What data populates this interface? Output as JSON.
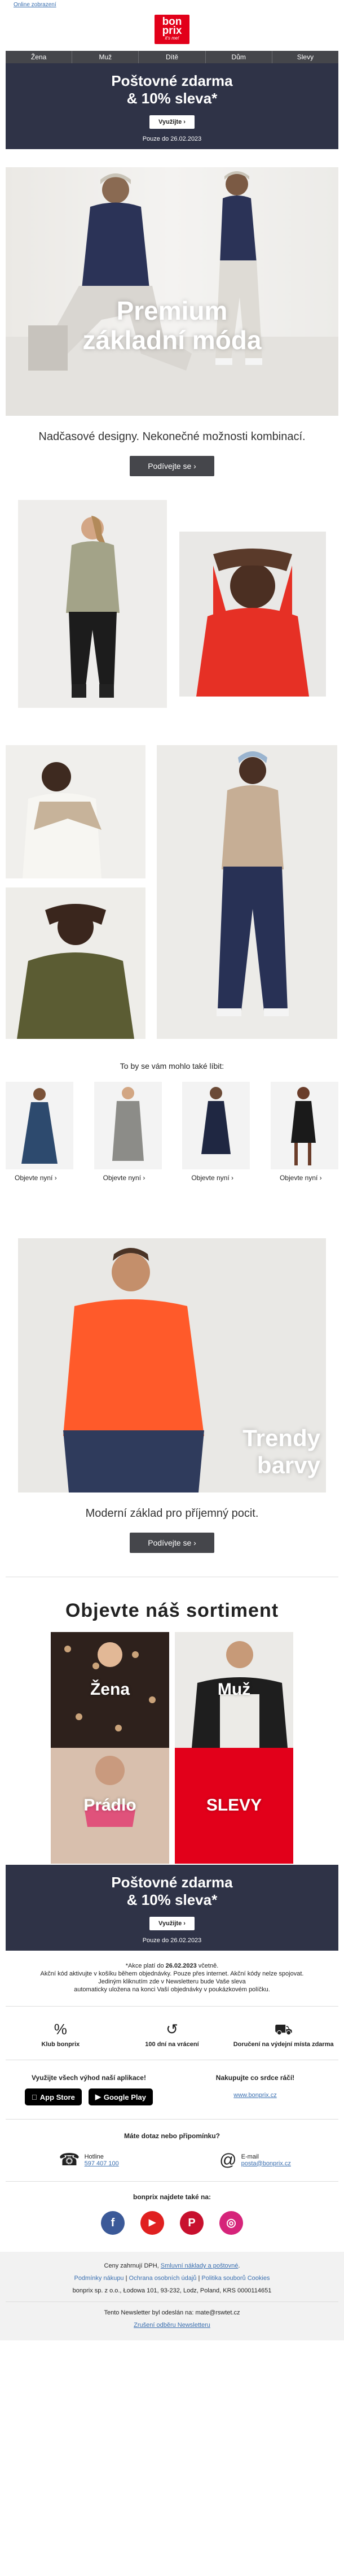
{
  "top_link": "Online zobrazení",
  "logo": {
    "line1": "bon",
    "line2": "prix",
    "sub": "it's me!"
  },
  "nav": [
    "Žena",
    "Muž",
    "Dítě",
    "Dům",
    "Slevy"
  ],
  "promo": {
    "line1": "Poštovné zdarma",
    "line2": "& 10% sleva*",
    "button": "Využijte ›",
    "note": "Pouze do 26.02.2023"
  },
  "hero": {
    "line1": "Premium",
    "line2": "základní móda",
    "tagline": "Nadčasové designy. Nekonečné možnosti kombinací.",
    "cta": "Podívejte se ›"
  },
  "recommend": {
    "title": "To by se vám mohlo také líbit:",
    "items": [
      {
        "label": "Objevte nyní ›"
      },
      {
        "label": "Objevte nyní ›"
      },
      {
        "label": "Objevte nyní ›"
      },
      {
        "label": "Objevte nyní ›"
      }
    ]
  },
  "trend": {
    "line1": "Trendy",
    "line2": "barvy",
    "tagline": "Moderní základ pro příjemný pocit.",
    "cta": "Podívejte se ›"
  },
  "sortiment": {
    "title": "Objevte náš sortiment",
    "tiles": [
      "Žena",
      "Muž",
      "Prádlo",
      "SLEVY"
    ]
  },
  "promo2": {
    "line1": "Poštovné zdarma",
    "line2": "& 10% sleva*",
    "button": "Využijte ›",
    "note": "Pouze do 26.02.2023"
  },
  "fine_print": {
    "l1a": "*Akce platí do ",
    "l1b": "26.02.2023",
    "l1c": " včetně.",
    "l2": "Akční kód aktivujte v košíku během objednávky. Pouze přes internet. Akční kódy nelze spojovat.",
    "l3": "Jediným kliknutím zde v Newsletteru bude Vaše sleva",
    "l4": "automaticky uložena na konci Vaší objednávky v poukázkovém políčku."
  },
  "usp": [
    {
      "icon": "%",
      "label": "Klub bonprix"
    },
    {
      "icon": "↺",
      "label": "100 dní na vrácení"
    },
    {
      "icon": "⛟",
      "label": "Doručení na výdejní místa zdarma"
    }
  ],
  "apps": {
    "title": "Využijte všech výhod naší aplikace!",
    "appstore": "App Store",
    "googleplay": "Google Play",
    "shop_title": "Nakupujte co srdce ráčí!",
    "shop_link": "www.bonprix.cz"
  },
  "contact": {
    "title": "Máte dotaz nebo připomínku?",
    "phone_label": "Hotline",
    "phone": "597 407 100",
    "email_label": "E-mail",
    "email": "posta@bonprix.cz"
  },
  "social": {
    "title": "bonprix najdete také na:",
    "items": [
      "f",
      "▶",
      "P",
      "◎"
    ]
  },
  "footer": {
    "l1a": "Ceny zahrnují DPH, ",
    "l1b": "Smluvní náklady a poštovné",
    "l1c": ".",
    "links": [
      "Podmínky nákupu",
      "Ochrana osobních údajů",
      "Politika souborů Cookies"
    ],
    "address": "bonprix sp. z o.o., Łodowa 101, 93-232, Lodz, Poland, KRS 0000114651",
    "sent": "Tento Newsletter byl odeslán na: mate@rswtet.cz",
    "unsub": "Zrušení odběru Newsletteru"
  },
  "colors": {
    "brand": "#e2001a",
    "navy": "#2f3347",
    "nav_bg": "#45464b"
  }
}
